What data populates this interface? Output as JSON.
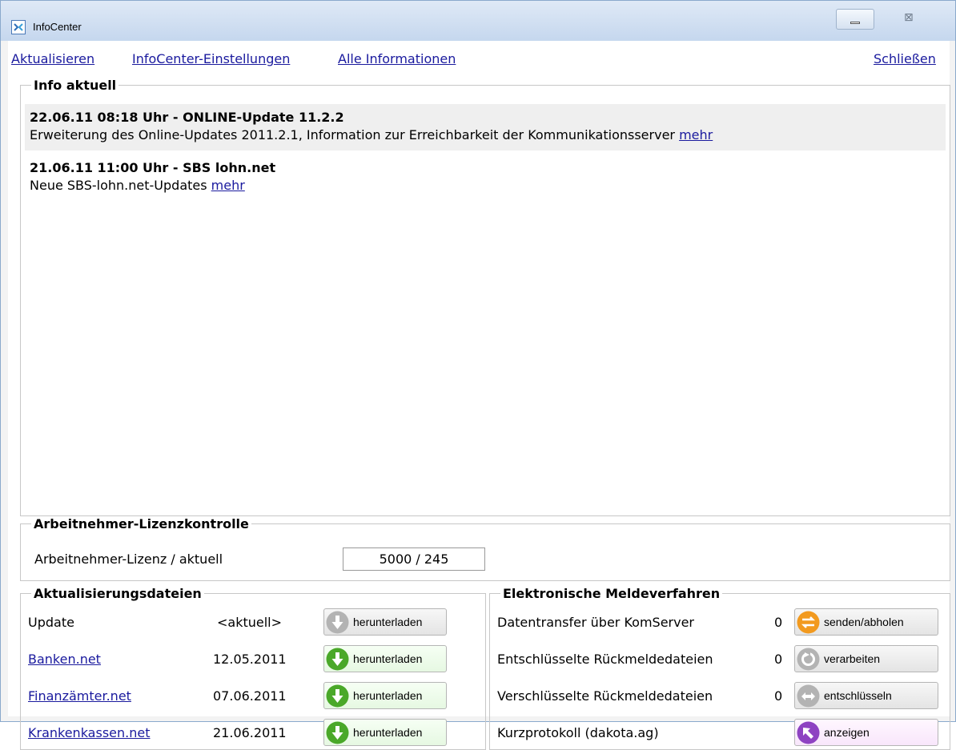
{
  "window": {
    "title": "InfoCenter"
  },
  "menu": {
    "refresh": "Aktualisieren",
    "settings": "InfoCenter-Einstellungen",
    "all_info": "Alle Informationen",
    "close": "Schließen"
  },
  "info": {
    "legend": "Info aktuell",
    "items": [
      {
        "title": "22.06.11 08:18 Uhr - ONLINE-Update 11.2.2",
        "text": "Erweiterung des Online-Updates 2011.2.1, Information zur Erreichbarkeit der Kommunikationsserver",
        "link": "mehr"
      },
      {
        "title": "21.06.11 11:00 Uhr - SBS lohn.net",
        "text": "Neue SBS-lohn.net-Updates",
        "link": "mehr"
      }
    ]
  },
  "license": {
    "legend": "Arbeitnehmer-Lizenzkontrolle",
    "label": "Arbeitnehmer-Lizenz / aktuell",
    "value": "5000 / 245"
  },
  "updates": {
    "legend": "Aktualisierungsdateien",
    "rows": [
      {
        "name": "Update",
        "date": "<aktuell>",
        "button": "herunterladen"
      },
      {
        "name": "Banken.net",
        "date": "12.05.2011",
        "button": "herunterladen"
      },
      {
        "name": "Finanzämter.net",
        "date": "07.06.2011",
        "button": "herunterladen"
      },
      {
        "name": "Krankenkassen.net",
        "date": "21.06.2011",
        "button": "herunterladen"
      }
    ]
  },
  "elektronisch": {
    "legend": "Elektronische Meldeverfahren",
    "rows": [
      {
        "label": "Datentransfer über KomServer",
        "count": "0",
        "button": "senden/abholen"
      },
      {
        "label": "Entschlüsselte Rückmeldedateien",
        "count": "0",
        "button": "verarbeiten"
      },
      {
        "label": "Verschlüsselte Rückmeldedateien",
        "count": "0",
        "button": "entschlüsseln"
      },
      {
        "label": "Kurzprotokoll (dakota.ag)",
        "button": "anzeigen"
      }
    ]
  },
  "icons": {
    "app": "infocenter-icon",
    "update_disabled": "download-arrow-gray-icon",
    "update_active": "download-arrow-green-icon",
    "transfer": "transfer-arrows-orange-icon",
    "process": "process-circle-gray-icon",
    "decrypt": "decrypt-arrows-gray-icon",
    "show": "show-arrow-purple-icon"
  },
  "colors": {
    "link": "#1a1a9e",
    "green": "#4aa829",
    "orange": "#f29a1f",
    "purple": "#8e43c2",
    "gray_icon": "#b3b3b3"
  }
}
